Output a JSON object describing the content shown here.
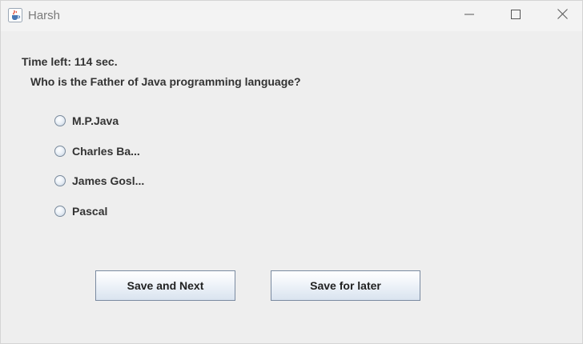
{
  "window": {
    "title": "Harsh",
    "icon": "java-cup-icon"
  },
  "quiz": {
    "timer_text": "Time left: 114 sec.",
    "question": "Who is the Father of Java programming language?",
    "options": [
      {
        "label": "M.P.Java",
        "selected": false
      },
      {
        "label": "Charles Ba...",
        "selected": false
      },
      {
        "label": "James Gosl...",
        "selected": false
      },
      {
        "label": "Pascal",
        "selected": false
      }
    ]
  },
  "buttons": {
    "save_next": "Save and Next",
    "save_later": "Save for later"
  }
}
